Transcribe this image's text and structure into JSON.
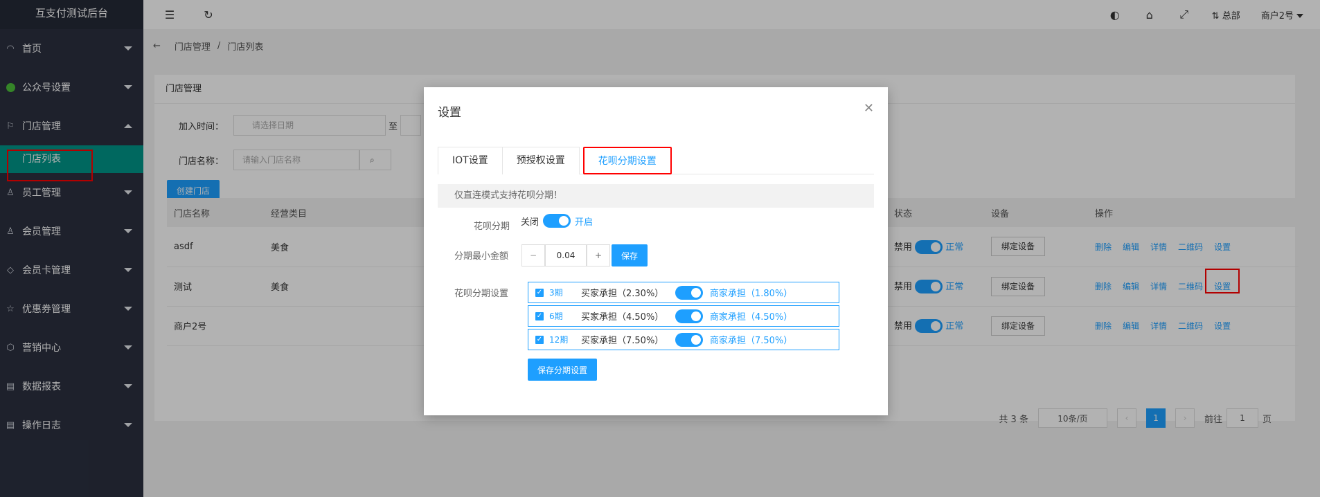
{
  "app": {
    "title": "互支付测试后台"
  },
  "sidebar": {
    "items": [
      {
        "label": "首页",
        "icon": "dashboard-icon",
        "expanded": false
      },
      {
        "label": "公众号设置",
        "icon": "wechat-icon",
        "expanded": false
      },
      {
        "label": "门店管理",
        "icon": "flag-icon",
        "expanded": true,
        "children": [
          {
            "label": "门店列表"
          }
        ]
      },
      {
        "label": "员工管理",
        "icon": "user-icon",
        "expanded": false
      },
      {
        "label": "会员管理",
        "icon": "member-icon",
        "expanded": false
      },
      {
        "label": "会员卡管理",
        "icon": "diamond-icon",
        "expanded": false
      },
      {
        "label": "优惠券管理",
        "icon": "star-icon",
        "expanded": false
      },
      {
        "label": "营销中心",
        "icon": "box-icon",
        "expanded": false
      },
      {
        "label": "数据报表",
        "icon": "clipboard-icon",
        "expanded": false
      },
      {
        "label": "操作日志",
        "icon": "log-icon",
        "expanded": false
      }
    ]
  },
  "topbar": {
    "branch": "总部",
    "account": "商户2号"
  },
  "breadcrumb": {
    "parent": "门店管理",
    "separator": "/",
    "current": "门店列表"
  },
  "card": {
    "title": "门店管理",
    "join_time_label": "加入时间：",
    "date_placeholder": "请选择日期",
    "to_label": "至",
    "store_name_label": "门店名称：",
    "store_name_placeholder": "请输入门店名称",
    "create_button": "创建门店"
  },
  "table": {
    "headers": {
      "name": "门店名称",
      "category": "经营类目",
      "status": "状态",
      "device": "设备",
      "actions": "操作"
    },
    "rows": [
      {
        "name": "asdf",
        "category": "美食"
      },
      {
        "name": "测试",
        "category": "美食"
      },
      {
        "name": "商户2号",
        "category": ""
      }
    ],
    "status_off": "禁用",
    "status_on": "正常",
    "device_button": "绑定设备",
    "actions": {
      "delete": "删除",
      "edit": "编辑",
      "detail": "详情",
      "qrcode": "二维码",
      "settings": "设置"
    }
  },
  "pager": {
    "total": "共 3 条",
    "page_size": "10条/页",
    "current_page": "1",
    "goto_label": "前往",
    "goto_value": "1",
    "page_unit": "页"
  },
  "modal": {
    "title": "设置",
    "tabs": [
      "IOT设置",
      "预授权设置",
      "花呗分期设置"
    ],
    "active_tab": 2,
    "notice": "仅直连模式支持花呗分期！",
    "huabei_label": "花呗分期",
    "off_label": "关闭",
    "on_label": "开启",
    "min_amount_label": "分期最小金额",
    "min_amount_value": "0.04",
    "save_button": "保存",
    "installment_label": "花呗分期设置",
    "installments": [
      {
        "period": "3期",
        "buyer": "买家承担（2.30%）",
        "merchant": "商家承担（1.80%）"
      },
      {
        "period": "6期",
        "buyer": "买家承担（4.50%）",
        "merchant": "商家承担（4.50%）"
      },
      {
        "period": "12期",
        "buyer": "买家承担（7.50%）",
        "merchant": "商家承担（7.50%）"
      }
    ],
    "save_installment_button": "保存分期设置"
  },
  "colors": {
    "sidebar_bg": "#2b3040",
    "accent": "#1e9fff",
    "active_menu": "#009688",
    "highlight_box": "#ff0000"
  }
}
